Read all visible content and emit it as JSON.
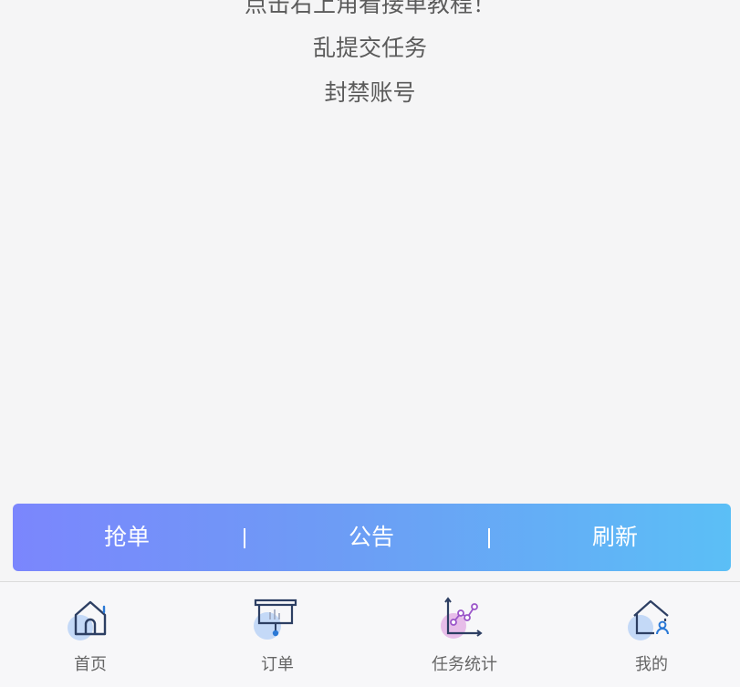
{
  "notice": {
    "lines": [
      "点击右上角看接单教程！",
      "乱提交任务",
      "封禁账号"
    ]
  },
  "actions": {
    "grab": "抢单",
    "separator": "|",
    "announcement": "公告",
    "refresh": "刷新"
  },
  "tabbar": {
    "tabs": [
      {
        "label": "首页",
        "icon": "home-icon"
      },
      {
        "label": "订单",
        "icon": "order-board-icon"
      },
      {
        "label": "任务统计",
        "icon": "stats-chart-icon"
      },
      {
        "label": "我的",
        "icon": "profile-house-icon"
      }
    ]
  },
  "colors": {
    "bar_gradient_start": "#7b86fd",
    "bar_gradient_end": "#5bbff6",
    "icon_stroke": "#2d3f63",
    "icon_blue_blob": "#c4d9f7",
    "icon_pink_blob": "#e7bde9",
    "icon_accent_blue": "#2b79d6",
    "icon_accent_purple": "#9b56c9"
  }
}
